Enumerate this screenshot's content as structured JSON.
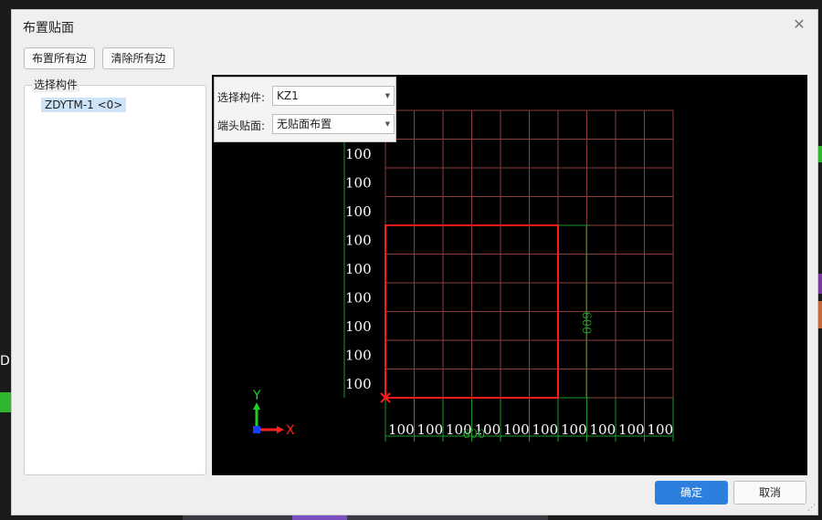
{
  "background": {
    "label": "D"
  },
  "dialog": {
    "title": "布置贴面",
    "close_icon": "close-icon",
    "toolbar": {
      "layout_all": "布置所有边",
      "clear_all": "清除所有边"
    },
    "tree": {
      "legend": "选择构件",
      "items": [
        {
          "label": "ZDYTM-1 <0>"
        }
      ]
    },
    "form": {
      "component_label": "选择构件:",
      "component_value": "KZ1",
      "end_face_label": "端头贴面:",
      "end_face_value": "无贴面布置"
    },
    "footer": {
      "ok": "确定",
      "cancel": "取消"
    }
  },
  "drawing": {
    "grid_color": "#8c3c3c",
    "dim_color": "#1e9a2d",
    "highlight_color": "#ff1a1a",
    "columns": 10,
    "rows": 10,
    "cell_mm": 100,
    "left_labels": [
      "100",
      "100",
      "100",
      "100",
      "100",
      "100",
      "100",
      "100",
      "100"
    ],
    "bottom_labels": [
      "100",
      "100",
      "100",
      "100",
      "100",
      "100",
      "100",
      "100",
      "100",
      "100"
    ],
    "rect": {
      "width_mm": 600,
      "height_mm": 600
    },
    "dim_width": "600",
    "dim_height": "600",
    "axis_x": "X",
    "axis_y": "Y"
  }
}
